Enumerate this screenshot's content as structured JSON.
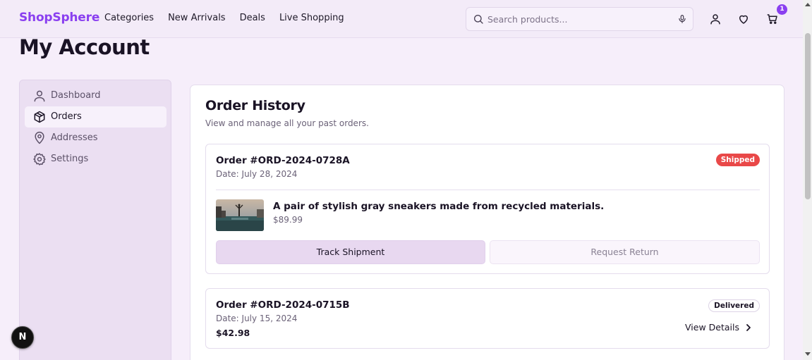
{
  "header": {
    "brand": "ShopSphere",
    "nav": [
      "Categories",
      "New Arrivals",
      "Deals",
      "Live Shopping"
    ],
    "search_placeholder": "Search products...",
    "cart_count": "1",
    "icons": [
      "search-icon",
      "microphone-icon",
      "user-icon",
      "heart-icon",
      "cart-icon"
    ]
  },
  "page": {
    "title": "My Account"
  },
  "sidebar": {
    "items": [
      {
        "label": "Dashboard",
        "icon": "user-icon"
      },
      {
        "label": "Orders",
        "icon": "package-icon",
        "active": true
      },
      {
        "label": "Addresses",
        "icon": "map-pin-icon"
      },
      {
        "label": "Settings",
        "icon": "gear-icon"
      }
    ]
  },
  "main": {
    "title": "Order History",
    "subtitle": "View and manage all your past orders.",
    "orders": [
      {
        "id": "Order #ORD-2024-0728A",
        "date": "Date: July 28, 2024",
        "status": "Shipped",
        "product_name": "A pair of stylish gray sneakers made from recycled materials.",
        "product_price": "$89.99",
        "primary_action": "Track Shipment",
        "secondary_action": "Request Return"
      },
      {
        "id": "Order #ORD-2024-0715B",
        "date": "Date: July 15, 2024",
        "status": "Delivered",
        "total": "$42.98",
        "action": "View Details"
      }
    ]
  },
  "floating": {
    "badge_letter": "N"
  },
  "colors": {
    "brand": "#8a3ff0",
    "shipped": "#e94848",
    "background": "#f6eefa",
    "sidebar": "#ebdff2"
  }
}
